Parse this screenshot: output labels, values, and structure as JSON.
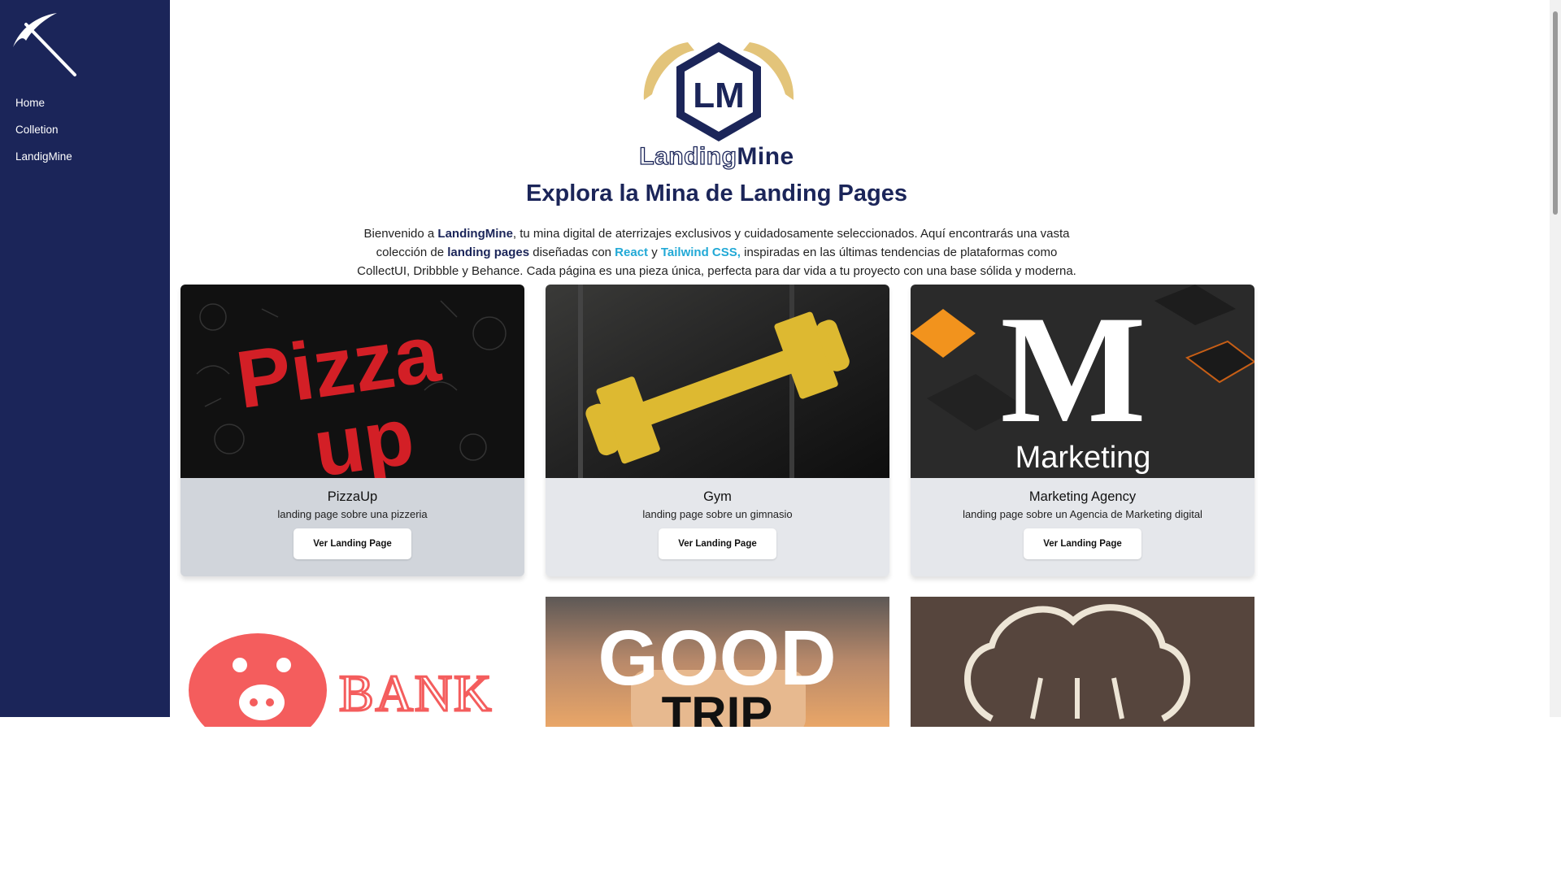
{
  "sidebar": {
    "logo_icon": "pickaxe-icon",
    "nav": [
      "Home",
      "Colletion",
      "LandigMine"
    ]
  },
  "brand": {
    "logo_letters": "LM",
    "name_part1": "Landing",
    "name_part2": "Mine"
  },
  "hero": {
    "title": "Explora la Mina de Landing Pages",
    "intro_1": "Bienvenido a ",
    "intro_brand": "LandingMine",
    "intro_2": ", tu mina digital de aterrizajes exclusivos y cuidadosamente seleccionados. Aquí encontrarás una vasta colección de ",
    "intro_lp": "landing pages",
    "intro_3": " diseñadas con ",
    "intro_react": "React",
    "intro_y": " y ",
    "intro_tailwind": "Tailwind CSS,",
    "intro_4": " inspiradas en las últimas tendencias de plataformas como CollectUI, Dribbble y Behance. Cada página es una pieza única, perfecta para dar vida a tu proyecto con una base sólida y moderna."
  },
  "cards": [
    {
      "title": "PizzaUp",
      "desc": "landing page sobre una pizzeria",
      "button": "Ver Landing Page",
      "image_text_1": "Pizza",
      "image_text_2": "up"
    },
    {
      "title": "Gym",
      "desc": "landing page sobre un gimnasio",
      "button": "Ver Landing Page"
    },
    {
      "title": "Marketing Agency",
      "desc": "landing page sobre un Agencia de Marketing digital",
      "button": "Ver Landing Page",
      "image_text_1": "M",
      "image_text_2": "Marketing"
    }
  ],
  "cards_row2": [
    {
      "image_text": "BANK"
    },
    {
      "image_text_1": "GOOD",
      "image_text_2": "TRIP"
    },
    {
      "image_icon": "chef-hat-icon"
    }
  ],
  "colors": {
    "sidebar": "#1b2559",
    "accent": "#22a9d6",
    "gold": "#e3c47a",
    "card": "#e5e7eb"
  }
}
